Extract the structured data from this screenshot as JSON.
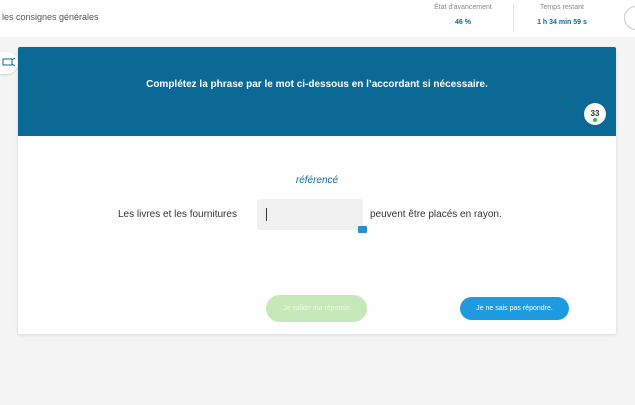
{
  "topbar": {
    "consignes_link": "les consignes générales",
    "progress_label": "État d'avancement",
    "progress_value": "46 %",
    "time_label": "Temps restant",
    "time_value": "1 h 34 min 59 s"
  },
  "question": {
    "instruction": "Complétez la phrase par le mot ci-dessous en l’accordant si nécessaire.",
    "word": "référencé",
    "sentence_before": "Les livres et les fournitures",
    "sentence_after": "peuvent être placés en rayon.",
    "answer_value": ""
  },
  "timer": {
    "seconds": "33",
    "total": "15"
  },
  "buttons": {
    "validate": "Je valide ma réponse",
    "dont_know": "Je ne sais pas répondre."
  },
  "colors": {
    "brand": "#0a6a95",
    "accent": "#1e9be0",
    "validate_disabled": "#c7e8b8"
  }
}
